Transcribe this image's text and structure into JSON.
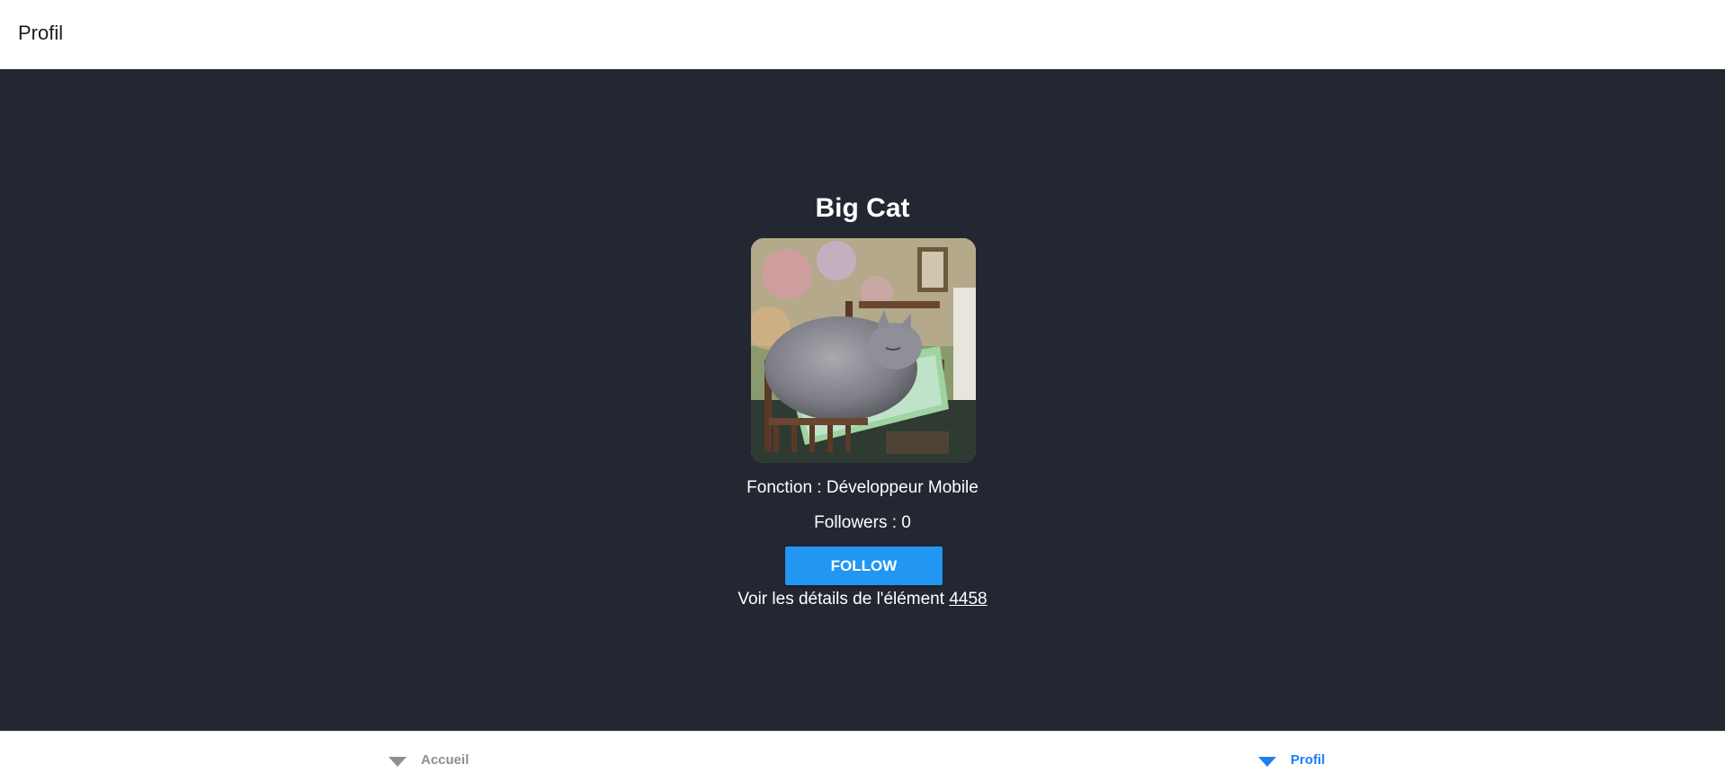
{
  "header": {
    "title": "Profil"
  },
  "profile": {
    "name": "Big Cat",
    "avatar_icon": "cat-photo",
    "fonction": "Fonction : Développeur Mobile",
    "followers": "Followers : 0",
    "follow_label": "FOLLOW",
    "details_prefix": "Voir les détails de l'élément ",
    "details_link": "4458"
  },
  "tabs": [
    {
      "label": "Accueil",
      "icon": "triangle-down-icon",
      "active": false
    },
    {
      "label": "Profil",
      "icon": "triangle-down-icon",
      "active": true
    }
  ],
  "colors": {
    "header_bg": "#ffffff",
    "main_bg": "#222731",
    "accent": "#2196f3",
    "tab_active": "#1a7ff5",
    "tab_inactive": "#8e8e93"
  }
}
